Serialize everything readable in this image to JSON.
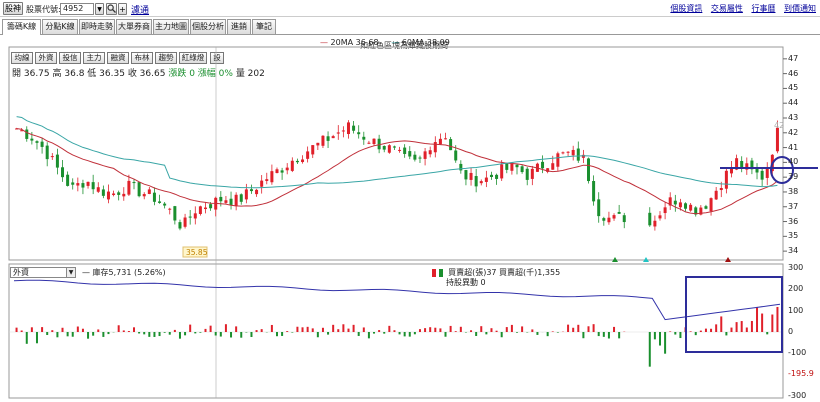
{
  "top": {
    "btn_single": "股神",
    "stock_code_label": "股票代號:",
    "stock_code_value": "4952",
    "filter_link": "濾通",
    "links": [
      "個股資訊",
      "交易屬性",
      "行事曆",
      "到價通知"
    ]
  },
  "tabs": [
    "籌碼K線",
    "分點K線",
    "即時走勢",
    "大單券商",
    "主力地圖",
    "個股分析",
    "進銷",
    "筆記"
  ],
  "chart_title": "如紅色區塊為庫藏股期間",
  "ma": {
    "ma20": "20MA 36.68",
    "ma60": "60MA 38.09"
  },
  "indicator_buttons": [
    "均線",
    "外資",
    "投信",
    "主力",
    "融資",
    "布林",
    "趨勢",
    "紅綠燈",
    "設"
  ],
  "ohlc": {
    "open": "開 36.75",
    "high": "高 36.8",
    "low": "低 36.35",
    "close": "收 36.65",
    "change": "漲跌 0",
    "pct": "漲幅 0%",
    "vol": "量 202"
  },
  "price_labels": {
    "last": "42",
    "low_marker": "35.85"
  },
  "price_axis": [
    "47",
    "46",
    "45",
    "44",
    "43",
    "42",
    "41",
    "40",
    "39",
    "38",
    "37",
    "36",
    "35",
    "34"
  ],
  "sub": {
    "select": "外資",
    "holding": "— 庫存5,731 (5.26%)",
    "buysell": "買賣超(張)37 買賣超(千)1,355",
    "change": "持股異動 0",
    "axis": [
      "300",
      "200",
      "100",
      "0",
      "-100",
      "-195.9",
      "-300"
    ]
  },
  "colors": {
    "up": "#e0202a",
    "down": "#1a8f2e",
    "ma20": "#c0303a",
    "ma60": "#3aa6a6",
    "holding": "#3333aa",
    "box": "#2d2d9a"
  },
  "chart_data": {
    "type": "candlestick",
    "price_range": [
      34,
      47.5
    ],
    "ma_labels": [
      "20MA",
      "60MA"
    ],
    "close_trend": [
      42.3,
      41.8,
      40.9,
      39.5,
      38.2,
      38.8,
      38.1,
      37.9,
      38.4,
      38.0,
      37.6,
      36.8,
      35.6,
      36.9,
      37.2,
      37.6,
      37.4,
      38.1,
      38.9,
      39.5,
      40.2,
      40.8,
      41.3,
      41.9,
      42.4,
      41.8,
      41.3,
      40.9,
      40.2,
      39.9,
      41.4,
      41.9,
      39.3,
      38.8,
      38.9,
      39.4,
      39.7,
      39.1,
      39.8,
      40.4,
      40.6,
      40.2,
      36.8,
      36.1,
      36.3,
      36.6,
      36.0,
      37.3,
      37.6,
      36.8,
      37.3,
      38.8,
      40.1,
      39.4,
      39.0,
      42.0
    ],
    "sub_range": [
      -300,
      300
    ]
  }
}
